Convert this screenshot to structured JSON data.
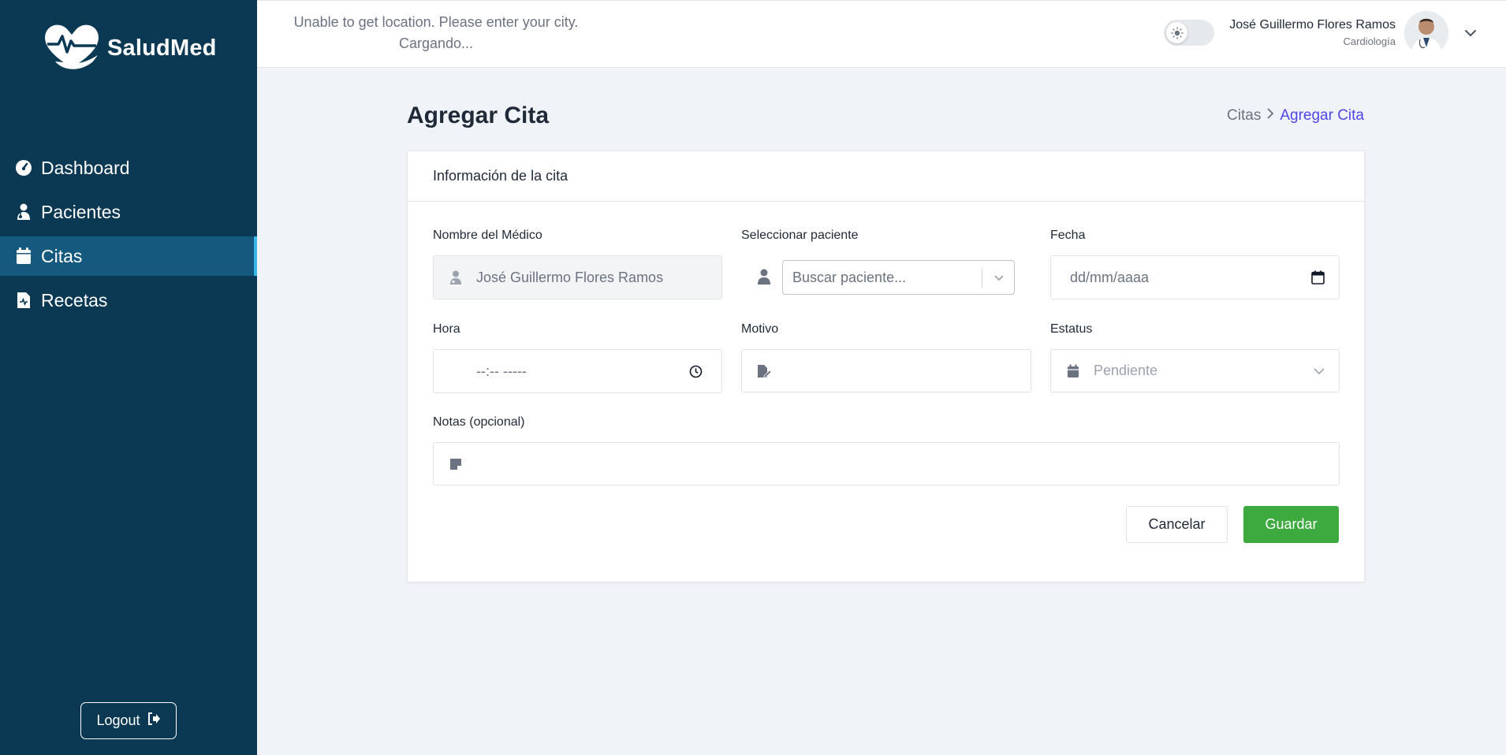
{
  "brand": {
    "name": "SaludMed",
    "primary": "#0b3954",
    "accent": "#3daa3f",
    "link": "#4f46e5"
  },
  "sidebar": {
    "items": [
      {
        "label": "Dashboard",
        "icon": "gauge-icon",
        "active": false
      },
      {
        "label": "Pacientes",
        "icon": "patient-icon",
        "active": false
      },
      {
        "label": "Citas",
        "icon": "calendar-icon",
        "active": true
      },
      {
        "label": "Recetas",
        "icon": "prescription-icon",
        "active": false
      }
    ],
    "logout_label": "Logout"
  },
  "topbar": {
    "weather_line1": "Unable to get location. Please enter your city.",
    "weather_line2": "Cargando...",
    "user_name": "José Guillermo Flores Ramos",
    "user_role": "Cardiología"
  },
  "page": {
    "title": "Agregar Cita",
    "breadcrumb": [
      "Citas",
      "Agregar Cita"
    ]
  },
  "form": {
    "card_title": "Información de la cita",
    "doctor_label": "Nombre del Médico",
    "doctor_value": "José Guillermo Flores Ramos",
    "patient_label": "Seleccionar paciente",
    "patient_placeholder": "Buscar paciente...",
    "date_label": "Fecha",
    "date_placeholder": "dd/mm/aaaa",
    "time_label": "Hora",
    "time_placeholder": "--:-- -----",
    "reason_label": "Motivo",
    "reason_value": "",
    "status_label": "Estatus",
    "status_value": "Pendiente",
    "notes_label": "Notas (opcional)",
    "notes_value": "",
    "cancel_label": "Cancelar",
    "save_label": "Guardar"
  }
}
